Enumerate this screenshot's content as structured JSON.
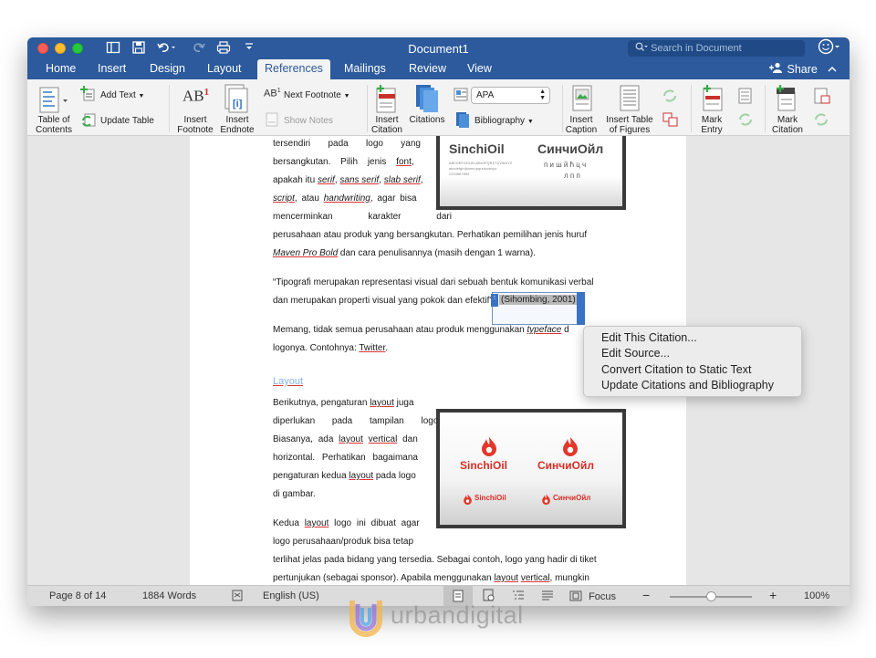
{
  "window": {
    "title": "Document1",
    "search_placeholder": "Search in Document"
  },
  "tabs": [
    {
      "label": "Home"
    },
    {
      "label": "Insert"
    },
    {
      "label": "Design"
    },
    {
      "label": "Layout"
    },
    {
      "label": "References"
    },
    {
      "label": "Mailings"
    },
    {
      "label": "Review"
    },
    {
      "label": "View"
    }
  ],
  "share_label": "Share",
  "ribbon": {
    "toc": "Table of\nContents",
    "add_text": "Add Text",
    "update_table": "Update Table",
    "insert_footnote": "Insert\nFootnote",
    "insert_endnote": "Insert\nEndnote",
    "next_footnote": "Next Footnote",
    "show_notes": "Show Notes",
    "insert_citation": "Insert\nCitation",
    "citations": "Citations",
    "style_value": "APA",
    "bibliography": "Bibliography",
    "insert_caption": "Insert\nCaption",
    "insert_table_figures": "Insert Table\nof Figures",
    "mark_entry": "Mark\nEntry",
    "mark_citation": "Mark\nCitation",
    "ab1": "AB",
    "ab1_sup": "1"
  },
  "document": {
    "lines_top": [
      "tersendiri pada logo yang",
      "bersangkutan. Pilih jenis font,",
      "apakah itu serif, sans serif, slab serif,",
      "script, atau handwriting, agar bisa",
      "mencerminkan karakter dari"
    ],
    "line_full_1": "perusahaan atau produk yang bersangkutan. Perhatikan pemilihan jenis huruf",
    "line_full_2a": "Maven Pro Bold",
    "line_full_2b": " dan cara penulisannya (masih dengan 1 warna).",
    "quote_1": "“Tipografi merupakan representasi visual dari sebuah bentuk komunikasi verbal",
    "quote_2": "dan merupakan properti visual yang pokok dan efektif”",
    "citation": "(Sihombing, 2001)",
    "para_3a": "Memang, tidak semua perusahaan atau produk menggunakan ",
    "para_3b": "typeface",
    "para_3c": " d",
    "para_4a": "logonya. Contohnya: ",
    "para_4b": "Twitter",
    "para_4c": ".",
    "heading": "Layout",
    "layout_lines": [
      "Berikutnya, pengaturan layout juga",
      "diperlukan pada tampilan logo.",
      "Biasanya, ada layout vertical dan",
      "horizontal. Perhatikan bagaimana",
      "pengaturan kedua layout pada logo",
      "di gambar."
    ],
    "kedua_1": "Kedua layout logo ini dibuat agar",
    "kedua_2": "logo perusahaan/produk bisa tetap",
    "full_3": "terlihat jelas pada bidang yang tersedia. Sebagai contoh, logo yang hadir di tiket",
    "full_4": "pertunjukan (sebagai sponsor). Apabila menggunakan layout vertical, mungkin"
  },
  "logo1": {
    "latin": "SinchiOil",
    "cyrillic": "СинчиОйл",
    "alphabet": "ABCDEFGHIJKLMNOPQRSTUVWXYZ",
    "alphabet2": "abcdefghijklmnopqrstuvwxyz",
    "digits": "1234567890",
    "cyr_small_1": "п и ш й  ћ ц ч",
    "cyr_small_2": "л п п"
  },
  "logo2": {
    "latin": "SinchiOil",
    "cyrillic": "СинчиОйл",
    "latin_small": "SinchiOil",
    "cyrillic_small": "СинчиОйл"
  },
  "context_menu": [
    {
      "label": "Edit This Citation..."
    },
    {
      "label": "Edit Source..."
    },
    {
      "label": "Convert Citation to Static Text"
    },
    {
      "label": "Update Citations and Bibliography"
    }
  ],
  "status": {
    "page": "Page 8 of 14",
    "words": "1884 Words",
    "language": "English (US)",
    "focus": "Focus",
    "zoom": "100%",
    "zoom_level": 0.5
  },
  "watermark": "urbandigital",
  "colors": {
    "titlebar": "#2c5a9c",
    "accent": "#2c5a9c",
    "logo_red": "#e2372a"
  }
}
